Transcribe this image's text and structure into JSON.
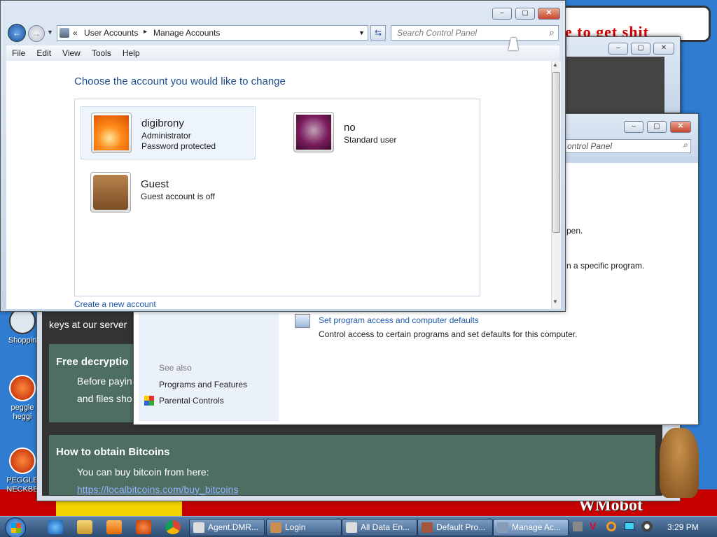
{
  "desktop": {
    "scribble_text": "e to get shit",
    "wmobot_text": "WMobot",
    "icons": [
      {
        "label": "Shoppin"
      },
      {
        "label": "peggle heggi"
      },
      {
        "label": "PEGGLE NECKBE"
      }
    ]
  },
  "browser_window": {
    "partial_text": "keys at our server",
    "free_decryption_title": "Free decryptio",
    "free_decryption_line1": "Before payin",
    "free_decryption_line2": "and files sho",
    "bitcoin_title": "How to obtain Bitcoins",
    "bitcoin_text": "You can buy bitcoin from here:",
    "bitcoin_link": "https://localbitcoins.com/buy_bitcoins"
  },
  "cp2": {
    "search_partial": "ontrol Panel",
    "text1": "pen.",
    "text2": "n a specific program.",
    "set_program_link": "Set program access and computer defaults",
    "set_program_desc": "Control access to certain programs and set defaults for this computer.",
    "see_also": "See also",
    "programs_features": "Programs and Features",
    "parental_controls": "Parental Controls"
  },
  "main_window": {
    "breadcrumb_prefix": "«",
    "breadcrumb_1": "User Accounts",
    "breadcrumb_sep": "▸",
    "breadcrumb_2": "Manage Accounts",
    "search_placeholder": "Search Control Panel",
    "menu": [
      "File",
      "Edit",
      "View",
      "Tools",
      "Help"
    ],
    "heading": "Choose the account you would like to change",
    "accounts": [
      {
        "name": "digibrony",
        "line1": "Administrator",
        "line2": "Password protected"
      },
      {
        "name": "no",
        "line1": "Standard user",
        "line2": ""
      },
      {
        "name": "Guest",
        "line1": "Guest account is off",
        "line2": ""
      }
    ],
    "create_link": "Create a new account"
  },
  "taskbar": {
    "items": [
      "Agent.DMR...",
      "Login",
      "All Data En...",
      "Default Pro...",
      "Manage Ac..."
    ],
    "clock": "3:29 PM"
  }
}
